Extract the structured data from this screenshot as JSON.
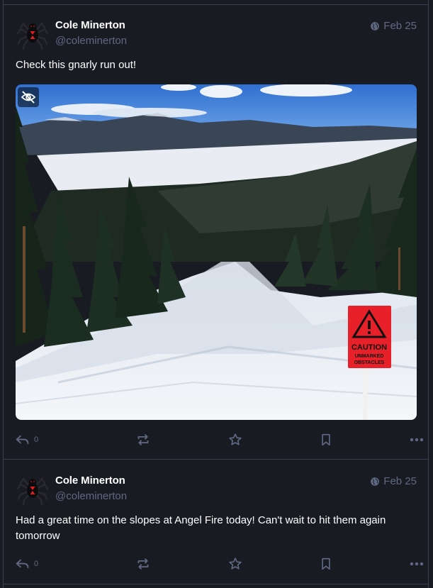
{
  "statuses": [
    {
      "display_name": "Cole Minerton",
      "handle": "@coleminerton",
      "visibility_icon": "globe-icon",
      "date": "Feb 25",
      "content": "Check this gnarly run out!",
      "media": {
        "sign_line1": "CAUTION",
        "sign_line2": "UNMARKED",
        "sign_line3": "OBSTACLES"
      },
      "reply_count": "0"
    },
    {
      "display_name": "Cole Minerton",
      "handle": "@coleminerton",
      "visibility_icon": "globe-icon",
      "date": "Feb 25",
      "content": "Had a great time on the slopes at Angel Fire today! Can't wait to hit them again tomorrow",
      "reply_count": "0"
    }
  ],
  "colors": {
    "background": "#191b22",
    "border": "#393f4f",
    "muted": "#606984",
    "text": "#ffffff",
    "sign_red": "#e8202a"
  }
}
